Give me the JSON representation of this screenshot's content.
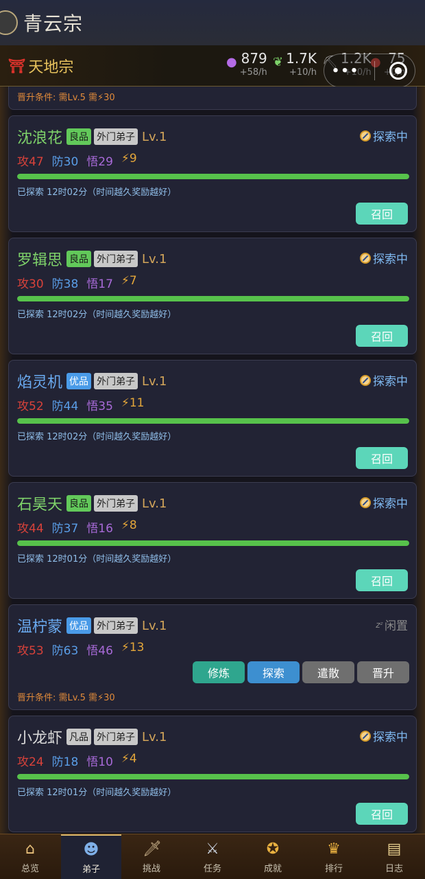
{
  "app": {
    "title": "青云宗"
  },
  "resources": {
    "sect_name": "天地宗",
    "items": [
      {
        "icon": "spirit-orb-icon",
        "value": "879",
        "rate": "+58/h",
        "color": "#b46be6"
      },
      {
        "icon": "herb-icon",
        "value": "1.7K",
        "rate": "+10/h",
        "color": "#7ed26a"
      },
      {
        "icon": "pickaxe-icon",
        "value": "1.2K",
        "rate": "+10/h",
        "color": "#9a9a9a"
      },
      {
        "icon": "food-icon",
        "value": "75",
        "rate": "+0/h",
        "color": "#d9423a"
      }
    ]
  },
  "top_card": {
    "promo": "晋升条件: 需Lv.5  需⚡30"
  },
  "disciples": [
    {
      "name": "沈浪花",
      "name_color": "#7ed26a",
      "quality": "良品",
      "quality_kind": "good",
      "rank": "外门弟子",
      "level": "Lv.1",
      "status": "探索中",
      "status_kind": "exploring",
      "atk": "攻47",
      "def": "防30",
      "wis": "悟29",
      "energy": "⚡9",
      "progress": 1.0,
      "explored": "已探索 12时02分（时间越久奖励越好）",
      "recall": "召回"
    },
    {
      "name": "罗辑思",
      "name_color": "#7ed26a",
      "quality": "良品",
      "quality_kind": "good",
      "rank": "外门弟子",
      "level": "Lv.1",
      "status": "探索中",
      "status_kind": "exploring",
      "atk": "攻30",
      "def": "防38",
      "wis": "悟17",
      "energy": "⚡7",
      "progress": 1.0,
      "explored": "已探索 12时02分（时间越久奖励越好）",
      "recall": "召回"
    },
    {
      "name": "焰灵机",
      "name_color": "#6aaaf0",
      "quality": "优品",
      "quality_kind": "fine",
      "rank": "外门弟子",
      "level": "Lv.1",
      "status": "探索中",
      "status_kind": "exploring",
      "atk": "攻52",
      "def": "防44",
      "wis": "悟35",
      "energy": "⚡11",
      "progress": 1.0,
      "explored": "已探索 12时02分（时间越久奖励越好）",
      "recall": "召回"
    },
    {
      "name": "石昊天",
      "name_color": "#7ed26a",
      "quality": "良品",
      "quality_kind": "good",
      "rank": "外门弟子",
      "level": "Lv.1",
      "status": "探索中",
      "status_kind": "exploring",
      "atk": "攻44",
      "def": "防37",
      "wis": "悟16",
      "energy": "⚡8",
      "progress": 1.0,
      "explored": "已探索 12时01分（时间越久奖励越好）",
      "recall": "召回"
    },
    {
      "name": "温柠蒙",
      "name_color": "#6aaaf0",
      "quality": "优品",
      "quality_kind": "fine",
      "rank": "外门弟子",
      "level": "Lv.1",
      "status": "闲置",
      "status_kind": "idle",
      "atk": "攻53",
      "def": "防63",
      "wis": "悟46",
      "energy": "⚡13",
      "actions": {
        "cultivate": "修炼",
        "explore": "探索",
        "dismiss": "遣散",
        "promote": "晋升"
      },
      "promo": "晋升条件: 需Lv.5  需⚡30"
    },
    {
      "name": "小龙虾",
      "name_color": "#d8d8d8",
      "quality": "凡品",
      "quality_kind": "plain",
      "rank": "外门弟子",
      "level": "Lv.1",
      "status": "探索中",
      "status_kind": "exploring",
      "atk": "攻24",
      "def": "防18",
      "wis": "悟10",
      "energy": "⚡4",
      "progress": 1.0,
      "explored": "已探索 12时01分（时间越久奖励越好）",
      "recall": "召回"
    }
  ],
  "nav": {
    "items": [
      {
        "label": "总览",
        "icon": "home-icon"
      },
      {
        "label": "弟子",
        "icon": "disciples-icon",
        "active": true
      },
      {
        "label": "挑战",
        "icon": "sword-icon"
      },
      {
        "label": "任务",
        "icon": "crossed-swords-icon"
      },
      {
        "label": "成就",
        "icon": "medal-icon"
      },
      {
        "label": "排行",
        "icon": "trophy-icon"
      },
      {
        "label": "日志",
        "icon": "scroll-icon"
      }
    ]
  }
}
